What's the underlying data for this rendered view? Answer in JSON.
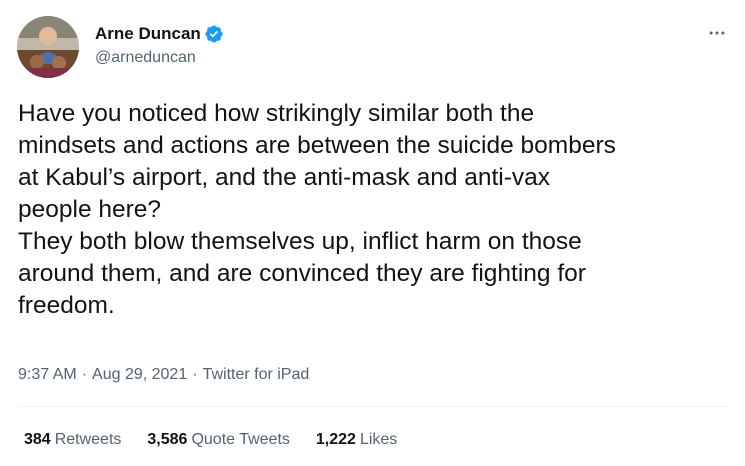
{
  "author": {
    "display_name": "Arne Duncan",
    "handle": "@arneduncan",
    "verified": true
  },
  "tweet": {
    "text": "Have you noticed how strikingly similar both the\nmindsets and actions are between the suicide bombers\nat Kabul’s airport, and the anti-mask and anti-vax\npeople here?\nThey both blow themselves up, inflict harm on those\naround them, and are convinced they are fighting for\nfreedom.",
    "time": "9:37 AM",
    "date": "Aug 29, 2021",
    "separator": "·",
    "source": "Twitter for iPad"
  },
  "stats": {
    "retweets_count": "384",
    "retweets_label": "Retweets",
    "quotes_count": "3,586",
    "quotes_label": "Quote Tweets",
    "likes_count": "1,222",
    "likes_label": "Likes"
  },
  "colors": {
    "text_primary": "#0f1419",
    "text_secondary": "#536471",
    "verified_blue": "#1d9bf0",
    "divider": "#eff3f4"
  },
  "icons": {
    "verified": "verified-badge-icon",
    "more": "more-horizontal-icon"
  }
}
